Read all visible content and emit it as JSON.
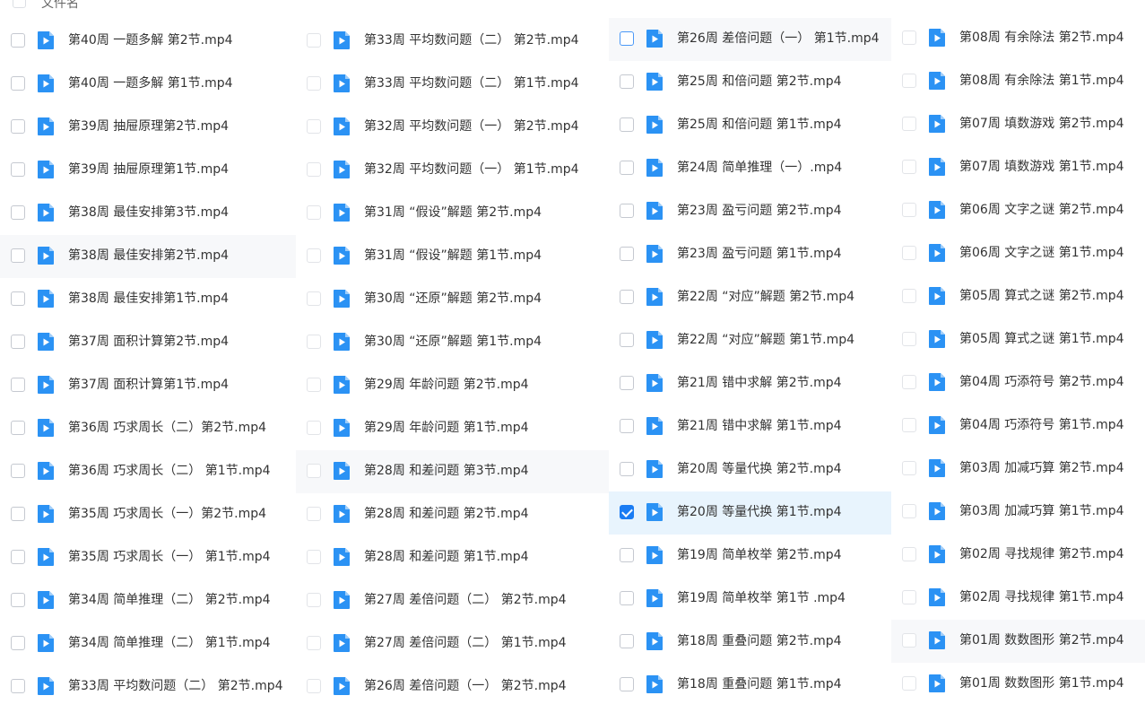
{
  "header": {
    "column_label": "文件名"
  },
  "file_icon": "video-file-icon",
  "accent_color": "#1a7cf3",
  "columns": [
    {
      "files": [
        "第40周 一题多解 第2节.mp4",
        "第40周 一题多解 第1节.mp4",
        "第39周 抽屉原理第2节.mp4",
        "第39周 抽屉原理第1节.mp4",
        "第38周 最佳安排第3节.mp4",
        "第38周 最佳安排第2节.mp4",
        "第38周 最佳安排第1节.mp4",
        "第37周 面积计算第2节.mp4",
        "第37周 面积计算第1节.mp4",
        "第36周 巧求周长（二）第2节.mp4",
        "第36周 巧求周长（二） 第1节.mp4",
        "第35周 巧求周长（一）第2节.mp4",
        "第35周 巧求周长（一） 第1节.mp4",
        "第34周 简单推理（二） 第2节.mp4",
        "第34周 简单推理（二） 第1节.mp4",
        "第33周 平均数问题（二） 第2节.mp4"
      ]
    },
    {
      "files": [
        "第33周 平均数问题（二） 第2节.mp4",
        "第33周 平均数问题（二） 第1节.mp4",
        "第32周 平均数问题（一） 第2节.mp4",
        "第32周 平均数问题（一） 第1节.mp4",
        "第31周 “假设”解题 第2节.mp4",
        "第31周 “假设”解题 第1节.mp4",
        "第30周 “还原”解题 第2节.mp4",
        "第30周 “还原”解题 第1节.mp4",
        "第29周 年龄问题 第2节.mp4",
        "第29周 年龄问题 第1节.mp4",
        "第28周 和差问题 第3节.mp4",
        "第28周 和差问题 第2节.mp4",
        "第28周 和差问题 第1节.mp4",
        "第27周 差倍问题（二） 第2节.mp4",
        "第27周 差倍问题（二） 第1节.mp4",
        "第26周 差倍问题（一） 第2节.mp4"
      ]
    },
    {
      "files": [
        "第26周 差倍问题（一） 第1节.mp4",
        "第25周 和倍问题 第2节.mp4",
        "第25周 和倍问题 第1节.mp4",
        "第24周 简单推理（一）.mp4",
        "第23周 盈亏问题 第2节.mp4",
        "第23周 盈亏问题 第1节.mp4",
        "第22周 “对应”解题 第2节.mp4",
        "第22周 “对应”解题 第1节.mp4",
        "第21周 错中求解 第2节.mp4",
        "第21周 错中求解 第1节.mp4",
        "第20周 等量代换 第2节.mp4",
        "第20周 等量代换 第1节.mp4",
        "第19周 简单枚举 第2节.mp4",
        "第19周 简单枚举 第1节 .mp4",
        "第18周 重叠问题 第2节.mp4",
        "第18周 重叠问题 第1节.mp4"
      ]
    },
    {
      "files": [
        "第08周 有余除法 第2节.mp4",
        "第08周 有余除法 第1节.mp4",
        "第07周 填数游戏 第2节.mp4",
        "第07周 填数游戏 第1节.mp4",
        "第06周 文字之谜 第2节.mp4",
        "第06周 文字之谜 第1节.mp4",
        "第05周 算式之谜 第2节.mp4",
        "第05周 算式之谜 第1节.mp4",
        "第04周 巧添符号 第2节.mp4",
        "第04周 巧添符号 第1节.mp4",
        "第03周 加减巧算 第2节.mp4",
        "第03周 加减巧算 第1节.mp4",
        "第02周 寻找规律 第2节.mp4",
        "第02周 寻找规律 第1节.mp4",
        "第01周 数数图形 第2节.mp4",
        "第01周 数数图形 第1节.mp4"
      ]
    }
  ],
  "checked_file": "第20周 等量代换 第1节.mp4",
  "focused_file": "第26周 差倍问题（一） 第1节.mp4"
}
